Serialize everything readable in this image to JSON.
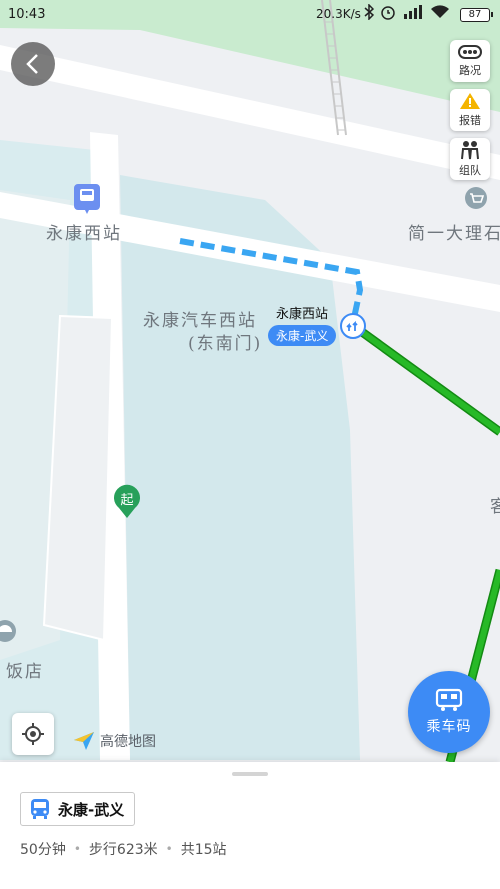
{
  "status_bar": {
    "time": "10:43",
    "network_speed": "20.3K/s",
    "battery": "87",
    "icons": [
      "bluetooth-icon",
      "alarm-icon",
      "signal-icon",
      "wifi-icon"
    ]
  },
  "map": {
    "labels": {
      "west_station_left": "永康西站",
      "west_station_entrance": "永康汽车西站",
      "entrance_gate": "(东南门)",
      "shop_right": "简一大理石",
      "restaurant": "饭店",
      "partial_right": "客"
    },
    "station": {
      "name": "永康西站",
      "route_badge": "永康-武义"
    },
    "start_pin": "起",
    "colors": {
      "route_green": "#1aa31a",
      "walk_blue": "#3aa6f2",
      "accent": "#3d8bf5",
      "green_area": "#c9ebcf"
    }
  },
  "controls": {
    "traffic": "路况",
    "report": "报错",
    "team": "组队",
    "ride_code": "乘车码",
    "logo_text": "高德地图"
  },
  "panel": {
    "route_name": "永康-武义",
    "duration": "50分钟",
    "walk": "步行623米",
    "stops": "共15站"
  }
}
